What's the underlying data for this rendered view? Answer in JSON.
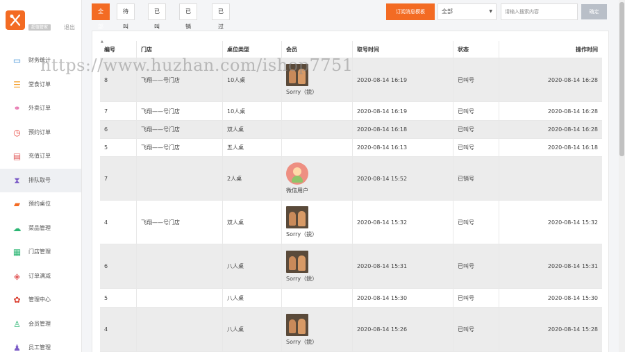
{
  "sidebar": {
    "shop_name": "超值管家",
    "logout": "退出",
    "items": [
      {
        "label": "财务统计",
        "icon": "monitor-icon",
        "color": "#3d8fd6"
      },
      {
        "label": "堂食订单",
        "icon": "list-icon",
        "color": "#f39a1f"
      },
      {
        "label": "外卖订单",
        "icon": "bike-icon",
        "color": "#e25ba0"
      },
      {
        "label": "预约订单",
        "icon": "alarm-clock-icon",
        "color": "#e8453c"
      },
      {
        "label": "充值订单",
        "icon": "card-icon",
        "color": "#e25d5d"
      },
      {
        "label": "排队取号",
        "icon": "hourglass-icon",
        "color": "#7b5bc7",
        "active": true
      },
      {
        "label": "预约桌位",
        "icon": "ktv-icon",
        "color": "#f36b23"
      },
      {
        "label": "菜品管理",
        "icon": "cloud-icon",
        "color": "#2bb673"
      },
      {
        "label": "门店管理",
        "icon": "grid-icon",
        "color": "#2bb673"
      },
      {
        "label": "订单满减",
        "icon": "tag-icon",
        "color": "#e25d5d"
      },
      {
        "label": "管理中心",
        "icon": "gear-icon",
        "color": "#d93a2b"
      },
      {
        "label": "会员管理",
        "icon": "user-icon",
        "color": "#2bb673"
      },
      {
        "label": "员工管理",
        "icon": "users-icon",
        "color": "#7b5bc7"
      }
    ]
  },
  "toolbar": {
    "tabs": [
      "全部",
      "待叫号",
      "已叫号",
      "已销号",
      "已过号"
    ],
    "active_tab": 0,
    "template_button": "订阅消息模板",
    "select_value": "全部",
    "search_placeholder": "请输入搜索内容",
    "confirm_button": "确定"
  },
  "table": {
    "headers": [
      "编号",
      "门店",
      "桌位类型",
      "会员",
      "取号时间",
      "状态",
      "操作时间"
    ],
    "rows": [
      {
        "no": "8",
        "store": "飞翔——号门店",
        "table_type": "10人桌",
        "avatar": "photo",
        "member": "Sorry（鋭）",
        "take_time": "2020-08-14 16:19",
        "status": "已叫号",
        "op_time": "2020-08-14 16:28"
      },
      {
        "no": "7",
        "store": "飞翔——号门店",
        "table_type": "10人桌",
        "avatar": "",
        "member": "",
        "take_time": "2020-08-14 16:19",
        "status": "已叫号",
        "op_time": "2020-08-14 16:28"
      },
      {
        "no": "6",
        "store": "飞翔——号门店",
        "table_type": "双人桌",
        "avatar": "",
        "member": "",
        "take_time": "2020-08-14 16:18",
        "status": "已叫号",
        "op_time": "2020-08-14 16:28"
      },
      {
        "no": "5",
        "store": "飞翔——号门店",
        "table_type": "五人桌",
        "avatar": "",
        "member": "",
        "take_time": "2020-08-14 16:13",
        "status": "已叫号",
        "op_time": "2020-08-14 16:18"
      },
      {
        "no": "7",
        "store": "",
        "table_type": "2人桌",
        "avatar": "wechat",
        "member": "微信用户",
        "take_time": "2020-08-14 15:52",
        "status": "已销号",
        "op_time": ""
      },
      {
        "no": "4",
        "store": "飞翔——号门店",
        "table_type": "双人桌",
        "avatar": "photo",
        "member": "Sorry（鋭）",
        "take_time": "2020-08-14 15:32",
        "status": "已叫号",
        "op_time": "2020-08-14 15:32"
      },
      {
        "no": "6",
        "store": "",
        "table_type": "八人桌",
        "avatar": "photo",
        "member": "Sorry（鋭）",
        "take_time": "2020-08-14 15:31",
        "status": "已叫号",
        "op_time": "2020-08-14 15:31"
      },
      {
        "no": "5",
        "store": "",
        "table_type": "八人桌",
        "avatar": "",
        "member": "",
        "take_time": "2020-08-14 15:30",
        "status": "已叫号",
        "op_time": "2020-08-14 15:30"
      },
      {
        "no": "4",
        "store": "",
        "table_type": "八人桌",
        "avatar": "photo",
        "member": "Sorry（鋭）",
        "take_time": "2020-08-14 15:26",
        "status": "已叫号",
        "op_time": "2020-08-14 15:28"
      }
    ]
  },
  "watermark": "https://www.huzhan.com/ishop7751",
  "colors": {
    "accent": "#f36b23",
    "confirm": "#b9bfc8"
  }
}
